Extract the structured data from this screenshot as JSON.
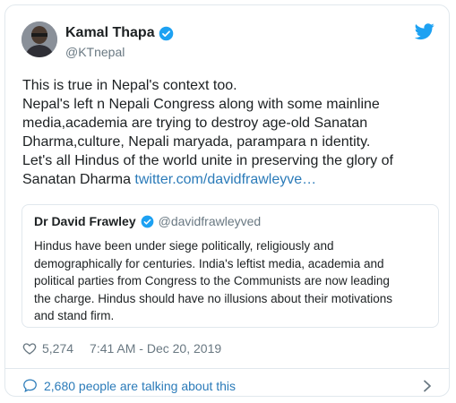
{
  "author": {
    "name": "Kamal Thapa",
    "handle": "@KTnepal",
    "avatar_icon": "profile-photo",
    "verified_icon": "verified-badge-icon"
  },
  "tweet": {
    "lines": [
      "This is true in Nepal's context too.",
      "Nepal's left n Nepali Congress along with some mainline",
      "media,academia are trying to destroy age-old Sanatan",
      "Dharma,culture, Nepali maryada, parampara n identity.",
      "Let's all Hindus of the world unite in preserving the glory of"
    ],
    "last_line_text": "Sanatan Dharma ",
    "link": "twitter.com/davidfrawleyve…"
  },
  "quoted": {
    "name": "Dr David Frawley",
    "handle": "@davidfrawleyved",
    "lines": [
      "Hindus have been under siege politically, religiously and",
      "demographically for centuries. India's leftist media, academia and",
      "political parties from Congress to the Communists are now leading",
      "the charge. Hindus should have no illusions about their motivations",
      "and stand firm."
    ]
  },
  "meta": {
    "likes": "5,274",
    "timestamp": "7:41 AM - Dec 20, 2019"
  },
  "footer": {
    "talking": "2,680 people are talking about this"
  },
  "colors": {
    "link": "#2b7bb9",
    "twitter_blue": "#1da1f2",
    "muted": "#697882",
    "border": "#e1e8ed"
  }
}
